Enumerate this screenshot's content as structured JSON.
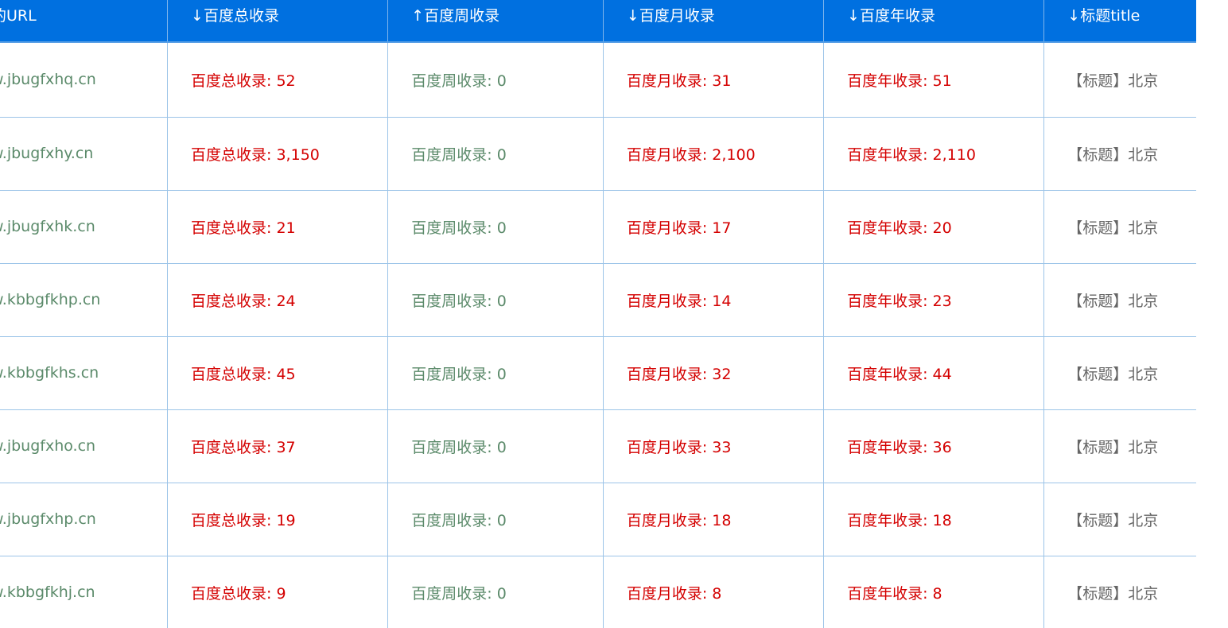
{
  "headers": {
    "url": "的URL",
    "total": "↓百度总收录",
    "week": "↑百度周收录",
    "month": "↓百度月收录",
    "year": "↓百度年收录",
    "title": "↓标题title"
  },
  "rows": [
    {
      "url": "w.jbugfxhq.cn",
      "total": "百度总收录: 52",
      "week": "百度周收录: 0",
      "month": "百度月收录: 31",
      "year": "百度年收录: 51",
      "title": "【标题】北京"
    },
    {
      "url": "w.jbugfxhy.cn",
      "total": "百度总收录: 3,150",
      "week": "百度周收录: 0",
      "month": "百度月收录: 2,100",
      "year": "百度年收录: 2,110",
      "title": "【标题】北京"
    },
    {
      "url": "w.jbugfxhk.cn",
      "total": "百度总收录: 21",
      "week": "百度周收录: 0",
      "month": "百度月收录: 17",
      "year": "百度年收录: 20",
      "title": "【标题】北京"
    },
    {
      "url": "w.kbbgfkhp.cn",
      "total": "百度总收录: 24",
      "week": "百度周收录: 0",
      "month": "百度月收录: 14",
      "year": "百度年收录: 23",
      "title": "【标题】北京"
    },
    {
      "url": "w.kbbgfkhs.cn",
      "total": "百度总收录: 45",
      "week": "百度周收录: 0",
      "month": "百度月收录: 32",
      "year": "百度年收录: 44",
      "title": "【标题】北京"
    },
    {
      "url": "w.jbugfxho.cn",
      "total": "百度总收录: 37",
      "week": "百度周收录: 0",
      "month": "百度月收录: 33",
      "year": "百度年收录: 36",
      "title": "【标题】北京"
    },
    {
      "url": "w.jbugfxhp.cn",
      "total": "百度总收录: 19",
      "week": "百度周收录: 0",
      "month": "百度月收录: 18",
      "year": "百度年收录: 18",
      "title": "【标题】北京"
    },
    {
      "url": "w.kbbgfkhj.cn",
      "total": "百度总收录: 9",
      "week": "百度周收录: 0",
      "month": "百度月收录: 8",
      "year": "百度年收录: 8",
      "title": "【标题】北京"
    }
  ],
  "colors": {
    "header_bg": "#0070e0",
    "header_text": "#ffffff",
    "count_red": "#d40000",
    "url_green": "#5b8a6a",
    "title_gray": "#666666",
    "grid_line": "#9cc4e8"
  }
}
